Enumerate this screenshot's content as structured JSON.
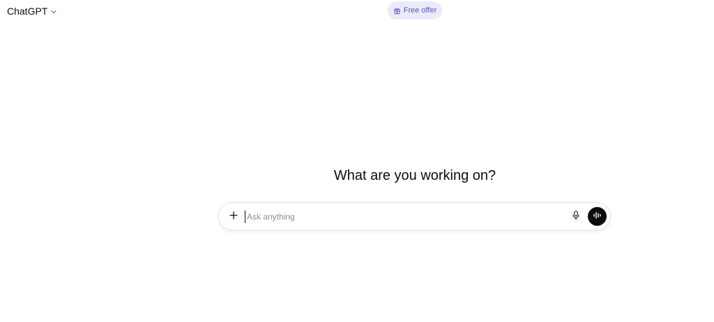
{
  "header": {
    "model_name": "ChatGPT",
    "model_menu_icon": "chevron-down-icon",
    "free_offer_label": "Free offer",
    "free_offer_icon": "gift-icon"
  },
  "main": {
    "heading": "What are you working on?"
  },
  "composer": {
    "placeholder": "Ask anything",
    "value": "",
    "attach_icon": "plus-icon",
    "mic_icon": "microphone-icon",
    "voice_icon": "voice-mode-icon"
  },
  "colors": {
    "accent": "#5b51c4",
    "offer_bg": "#ebebf8",
    "text": "#0d0d0d",
    "placeholder": "#8e8e8e"
  }
}
